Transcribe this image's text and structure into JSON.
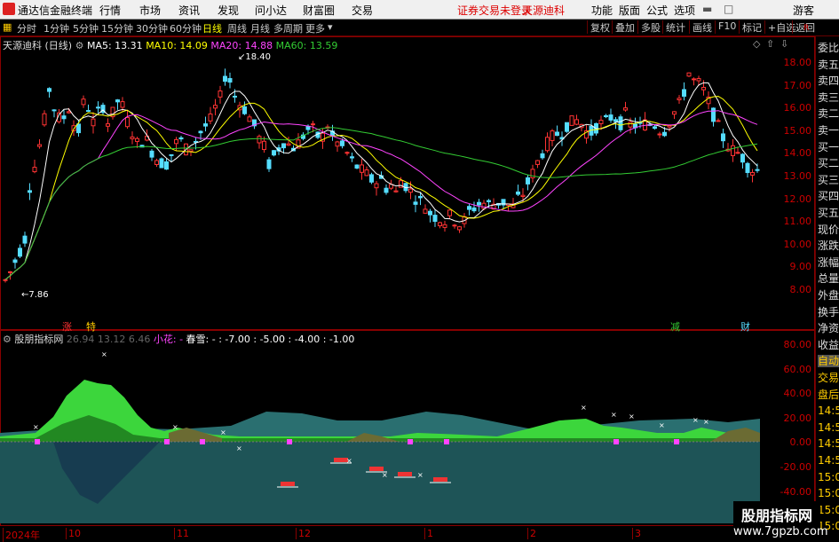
{
  "menubar": {
    "app_name": "通达信金融终端",
    "items": [
      "行情",
      "市场",
      "资讯",
      "发现",
      "问小达",
      "财富圈",
      "交易"
    ],
    "notice": "证券交易未登录",
    "notice_stock": "天源迪科",
    "right": [
      "功能",
      "版面",
      "公式",
      "选项"
    ],
    "user": "游客"
  },
  "toolbar": {
    "periods": [
      "分时",
      "1分钟",
      "5分钟",
      "15分钟",
      "30分钟",
      "60分钟",
      "日线",
      "周线",
      "月线",
      "多周期",
      "更多"
    ],
    "active": "日线",
    "right": [
      "复权",
      "叠加",
      "多股",
      "统计",
      "画线",
      "F10",
      "标记",
      "+自选",
      "返回"
    ]
  },
  "main_chart": {
    "title": "天源迪科 (日线)",
    "ma5": "MA5: 13.31",
    "ma10": "MA10: 14.09",
    "ma20": "MA20: 14.88",
    "ma60": "MA60: 13.59",
    "high_label": "18.40",
    "low_label": "7.86",
    "markers": [
      "涨",
      "特",
      "减",
      "财"
    ],
    "y_labels": [
      "18.00",
      "17.00",
      "16.00",
      "15.00",
      "14.00",
      "13.00",
      "12.00",
      "11.00",
      "10.00",
      "9.00",
      "8.00"
    ]
  },
  "indicator": {
    "name": "股朋指标网",
    "v1": "26.94",
    "v2": "13.12",
    "v3": "6.46",
    "flower": "小花: -",
    "spring": "春雪: - : -7.00 : -5.00 : -4.00 : -1.00",
    "y_labels": [
      "80.00",
      "60.00",
      "40.00",
      "20.00",
      "0.00",
      "-20.00",
      "-40.00"
    ]
  },
  "x_axis": [
    "2024年",
    "10",
    "11",
    "12",
    "1",
    "2",
    "3"
  ],
  "right_panel": {
    "items": [
      "委比",
      "卖五",
      "卖四",
      "卖三",
      "卖二",
      "卖一",
      "买一",
      "买二",
      "买三",
      "买四",
      "买五",
      "现价",
      "涨跌",
      "涨幅",
      "总量",
      "外盘",
      "换手",
      "净资",
      "收益",
      "自动",
      "交易",
      "盘后",
      "14:56",
      "14:56",
      "14:56",
      "14:56",
      "15:00",
      "15:00",
      "15:09",
      "15:09"
    ],
    "r_label": "R"
  },
  "watermark": {
    "line1": "股朋指标网",
    "line2": "www.7gpzb.com"
  },
  "colors": {
    "up": "#ff3333",
    "down": "#55ddff",
    "ma5": "#ffffff",
    "ma10": "#ffff00",
    "ma20": "#ff44ff",
    "ma60": "#33cc33",
    "axis": "#cc0000"
  }
}
